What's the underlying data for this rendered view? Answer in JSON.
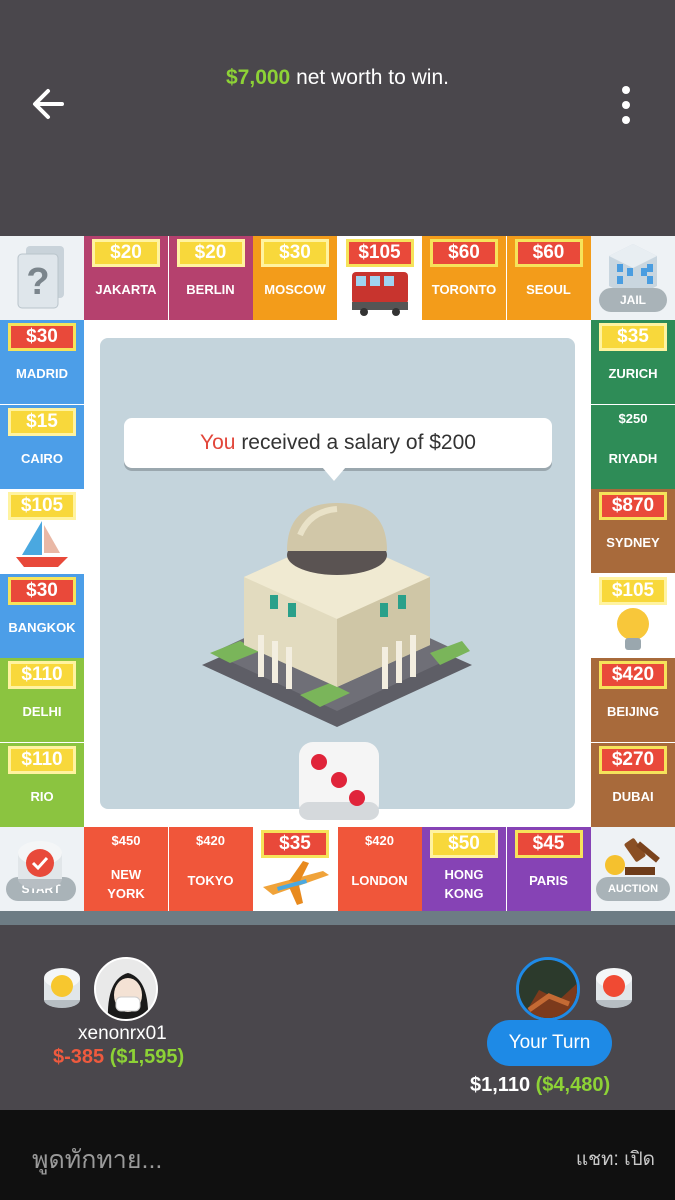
{
  "header": {
    "goal_amount": "$7,000",
    "goal_text": "net worth to win."
  },
  "board": {
    "top_row": [
      {
        "name": "JAKARTA",
        "price": "$20",
        "color": "#b5416e"
      },
      {
        "name": "BERLIN",
        "price": "$20",
        "color": "#b5416e"
      },
      {
        "name": "MOSCOW",
        "price": "$30",
        "color": "#f39c1a"
      },
      {
        "name": "",
        "price": "$105",
        "color": "#ffffff",
        "icon": "train-icon"
      },
      {
        "name": "TORONTO",
        "price": "$60",
        "color": "#f39c1a"
      },
      {
        "name": "SEOUL",
        "price": "$60",
        "color": "#f39c1a"
      }
    ],
    "left_col": [
      {
        "name": "MADRID",
        "price": "$30",
        "color": "#4c9ee8"
      },
      {
        "name": "CAIRO",
        "price": "$15",
        "color": "#4c9ee8"
      },
      {
        "name": "",
        "price": "$105",
        "color": "#ffffff",
        "icon": "sailboat-icon"
      },
      {
        "name": "BANGKOK",
        "price": "$30",
        "color": "#4c9ee8"
      },
      {
        "name": "DELHI",
        "price": "$110",
        "color": "#8bc440"
      },
      {
        "name": "RIO",
        "price": "$110",
        "color": "#8bc440"
      }
    ],
    "right_col": [
      {
        "name": "ZURICH",
        "price": "$35",
        "color": "#2e8c57"
      },
      {
        "name": "RIYADH",
        "price": "$250",
        "color": "#2e8c57"
      },
      {
        "name": "SYDNEY",
        "price": "$870",
        "color": "#a86a3b"
      },
      {
        "name": "",
        "price": "$105",
        "color": "#ffffff",
        "icon": "lightbulb-icon"
      },
      {
        "name": "BEIJING",
        "price": "$420",
        "color": "#a86a3b"
      },
      {
        "name": "DUBAI",
        "price": "$270",
        "color": "#a86a3b"
      }
    ],
    "bottom_row": [
      {
        "name": "NEW YORK",
        "price": "$450",
        "color": "#f0563a"
      },
      {
        "name": "TOKYO",
        "price": "$420",
        "color": "#f0563a"
      },
      {
        "name": "",
        "price": "$35",
        "color": "#ffffff",
        "icon": "airplane-icon"
      },
      {
        "name": "LONDON",
        "price": "$420",
        "color": "#f0563a"
      },
      {
        "name": "HONG KONG",
        "price": "$50",
        "color": "#8643b5"
      },
      {
        "name": "PARIS",
        "price": "$45",
        "color": "#8643b5"
      }
    ],
    "corners": {
      "top_left": "chance-card-icon",
      "top_right_label": "JAIL",
      "bottom_left_label": "START",
      "bottom_right_label": "AUCTION"
    },
    "message": {
      "you": "You",
      "rest": "received a salary of $200"
    },
    "dice_value": 3
  },
  "players": {
    "left": {
      "name": "xenonrx01",
      "delta": "$-385",
      "net": "($1,595)"
    },
    "right": {
      "turn_label": "Your Turn",
      "cash": "$1,110",
      "net": "($4,480)"
    }
  },
  "chat": {
    "placeholder": "พูดทักทาย...",
    "toggle": "แชท: เปิด"
  }
}
